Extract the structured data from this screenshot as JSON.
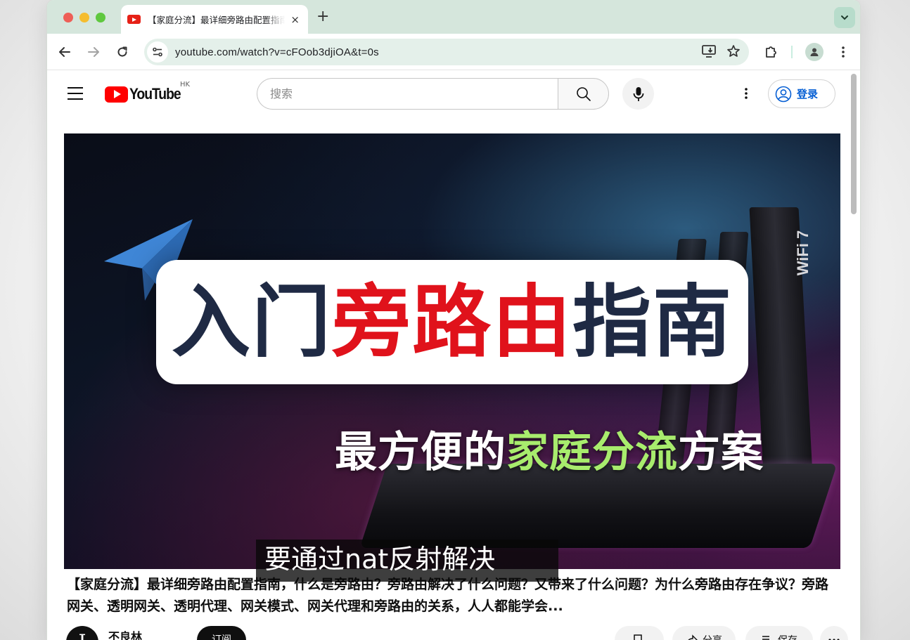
{
  "browser": {
    "tab": {
      "title": "【家庭分流】最详细旁路由配置指南，什么是旁路由？",
      "close_glyph": "×"
    },
    "new_tab_glyph": "+",
    "url": "youtube.com/watch?v=cFOob3djiOA&t=0s"
  },
  "youtube": {
    "logo_text": "YouTube",
    "region": "HK",
    "search": {
      "placeholder": "搜索",
      "value": ""
    },
    "signin_label": "登录"
  },
  "video": {
    "thumbnail": {
      "headline_dark_1": "入门",
      "headline_red": "旁路由",
      "headline_dark_2": "指南",
      "sub_white_1": "最方便的",
      "sub_green": "家庭分流",
      "sub_white_2": "方案",
      "router_label": "WiFi 7"
    },
    "title": "【家庭分流】最详细旁路由配置指南，什么是旁路由？旁路由解决了什么问题？又带来了什么问题？为什么旁路由存在争议？旁路网关、透明网关、透明代理、网关模式、网关代理和旁路由的关系，人人都能学会...",
    "subtitle_caption": "要通过nat反射解决",
    "channel": {
      "avatar_letter": "I",
      "name": "不良林"
    },
    "subscribe_label": "订阅",
    "actions": {
      "share": "分享",
      "save": "保存"
    }
  },
  "colors": {
    "tabstrip": "#d5e6dc",
    "omnibox": "#e4f0ea",
    "yt_red": "#ff0000",
    "link_blue": "#065fd4",
    "thumb_red": "#e0121b",
    "thumb_green": "#a8ec6d"
  }
}
